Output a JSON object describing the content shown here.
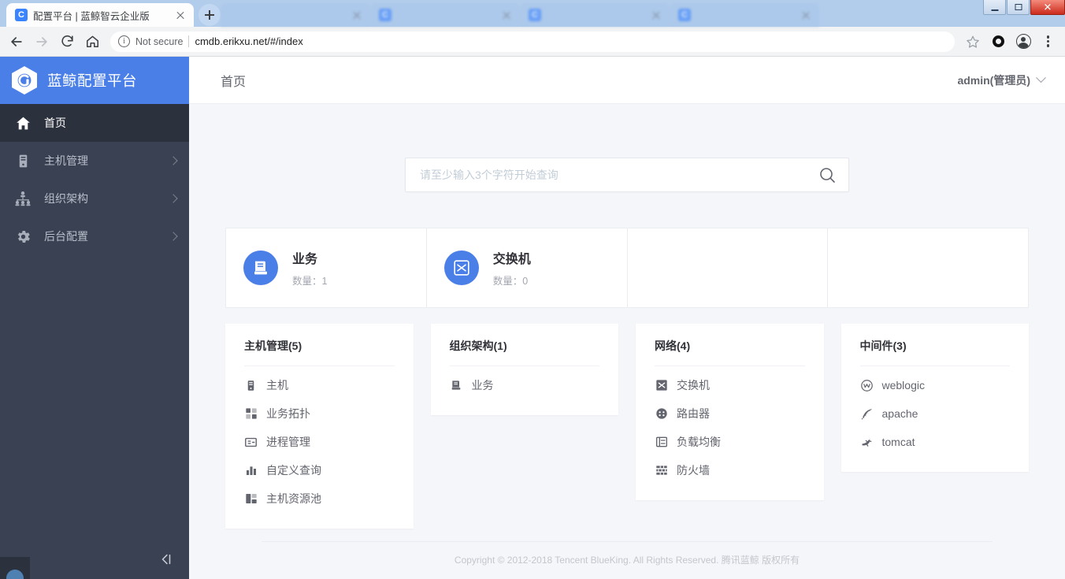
{
  "browser": {
    "tabs": [
      {
        "title": "配置平台 | 蓝鲸智云企业版",
        "active": true
      },
      {
        "title": "",
        "active": false
      },
      {
        "title": "",
        "active": false
      },
      {
        "title": "",
        "active": false
      },
      {
        "title": "",
        "active": false
      }
    ],
    "security_label": "Not secure",
    "url": "cmdb.erikxu.net/#/index",
    "window_controls": {
      "minimize": "minimize-icon",
      "maximize": "maximize-icon",
      "close": "✕"
    },
    "toolbar_icons": [
      "back-icon",
      "forward-icon",
      "reload-icon",
      "home-icon",
      "bookmark-star-icon",
      "extension-icon",
      "profile-avatar-icon",
      "chrome-menu-icon"
    ]
  },
  "sidebar": {
    "logo_text": "蓝鲸配置平台",
    "collapse_icon": "collapse-sidebar-icon",
    "items": [
      {
        "label": "首页",
        "icon": "home-icon",
        "active": true,
        "expandable": false
      },
      {
        "label": "主机管理",
        "icon": "server-icon",
        "active": false,
        "expandable": true
      },
      {
        "label": "组织架构",
        "icon": "org-tree-icon",
        "active": false,
        "expandable": true
      },
      {
        "label": "后台配置",
        "icon": "gear-icon",
        "active": false,
        "expandable": true
      }
    ]
  },
  "topbar": {
    "breadcrumb": "首页",
    "user": "admin(管理员)"
  },
  "search": {
    "placeholder": "请至少输入3个字符开始查询",
    "value": ""
  },
  "stat_cards": [
    {
      "name": "业务",
      "count_label": "数量：1",
      "icon": "business-doc-icon",
      "empty": false
    },
    {
      "name": "交换机",
      "count_label": "数量：0",
      "icon": "switch-icon",
      "empty": false
    },
    {
      "name": "",
      "count_label": "",
      "icon": "",
      "empty": true
    },
    {
      "name": "",
      "count_label": "",
      "icon": "",
      "empty": true
    }
  ],
  "panels": [
    {
      "title": "主机管理(5)",
      "items": [
        {
          "label": "主机",
          "icon": "server-icon"
        },
        {
          "label": "业务拓扑",
          "icon": "topology-icon"
        },
        {
          "label": "进程管理",
          "icon": "process-icon"
        },
        {
          "label": "自定义查询",
          "icon": "bar-chart-icon"
        },
        {
          "label": "主机资源池",
          "icon": "resource-pool-icon"
        }
      ]
    },
    {
      "title": "组织架构(1)",
      "items": [
        {
          "label": "业务",
          "icon": "business-doc-icon"
        }
      ]
    },
    {
      "title": "网络(4)",
      "items": [
        {
          "label": "交换机",
          "icon": "switch-icon"
        },
        {
          "label": "路由器",
          "icon": "router-icon"
        },
        {
          "label": "负载均衡",
          "icon": "load-balancer-icon"
        },
        {
          "label": "防火墙",
          "icon": "firewall-icon"
        }
      ]
    },
    {
      "title": "中间件(3)",
      "items": [
        {
          "label": "weblogic",
          "icon": "weblogic-icon"
        },
        {
          "label": "apache",
          "icon": "apache-feather-icon"
        },
        {
          "label": "tomcat",
          "icon": "tomcat-icon"
        }
      ]
    }
  ],
  "footer": "Copyright © 2012-2018 Tencent BlueKing. All Rights Reserved. 腾讯蓝鲸 版权所有",
  "colors": {
    "brand_blue": "#4b7fe8",
    "sidebar_bg": "#3a4152",
    "sidebar_active": "#2c313e",
    "page_bg": "#f4f6fa",
    "text_dark": "#313238",
    "text_muted": "#63656e"
  }
}
